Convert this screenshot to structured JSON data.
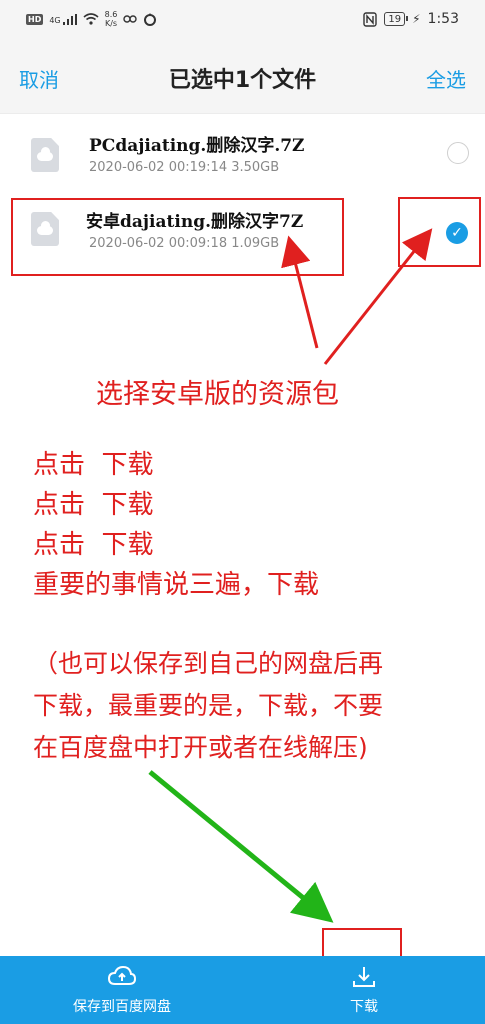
{
  "status_bar": {
    "hd": "HD",
    "signal": "4G",
    "speed_value": "8.6",
    "speed_unit": "K/s",
    "battery": "19",
    "time": "1:53"
  },
  "header": {
    "cancel": "取消",
    "title": "已选中1个文件",
    "select_all": "全选"
  },
  "files": [
    {
      "name": "PCdajiating.删除汉字.7Z",
      "date": "2020-06-02",
      "time": "00:19:14",
      "size": "3.50GB",
      "checked": false
    },
    {
      "name": "安卓dajiating.删除汉字7Z",
      "date": "2020-06-02",
      "time": "00:09:18",
      "size": "1.09GB",
      "checked": true
    }
  ],
  "annotations": {
    "select_android": "选择安卓版的资源包",
    "click_lines": [
      "点击  下载",
      "点击  下载",
      "点击  下载"
    ],
    "repeat_note": "重要的事情说三遍，下载",
    "paren_lines": [
      "（也可以保存到自己的网盘后再",
      "下载，最重要的是，下载，不要",
      "在百度盘中打开或者在线解压)"
    ]
  },
  "bottom_bar": {
    "save": "保存到百度网盘",
    "download": "下载"
  },
  "colors": {
    "accent": "#1a9de4",
    "annotation_red": "#e0201f",
    "annotation_green": "#22b418"
  }
}
